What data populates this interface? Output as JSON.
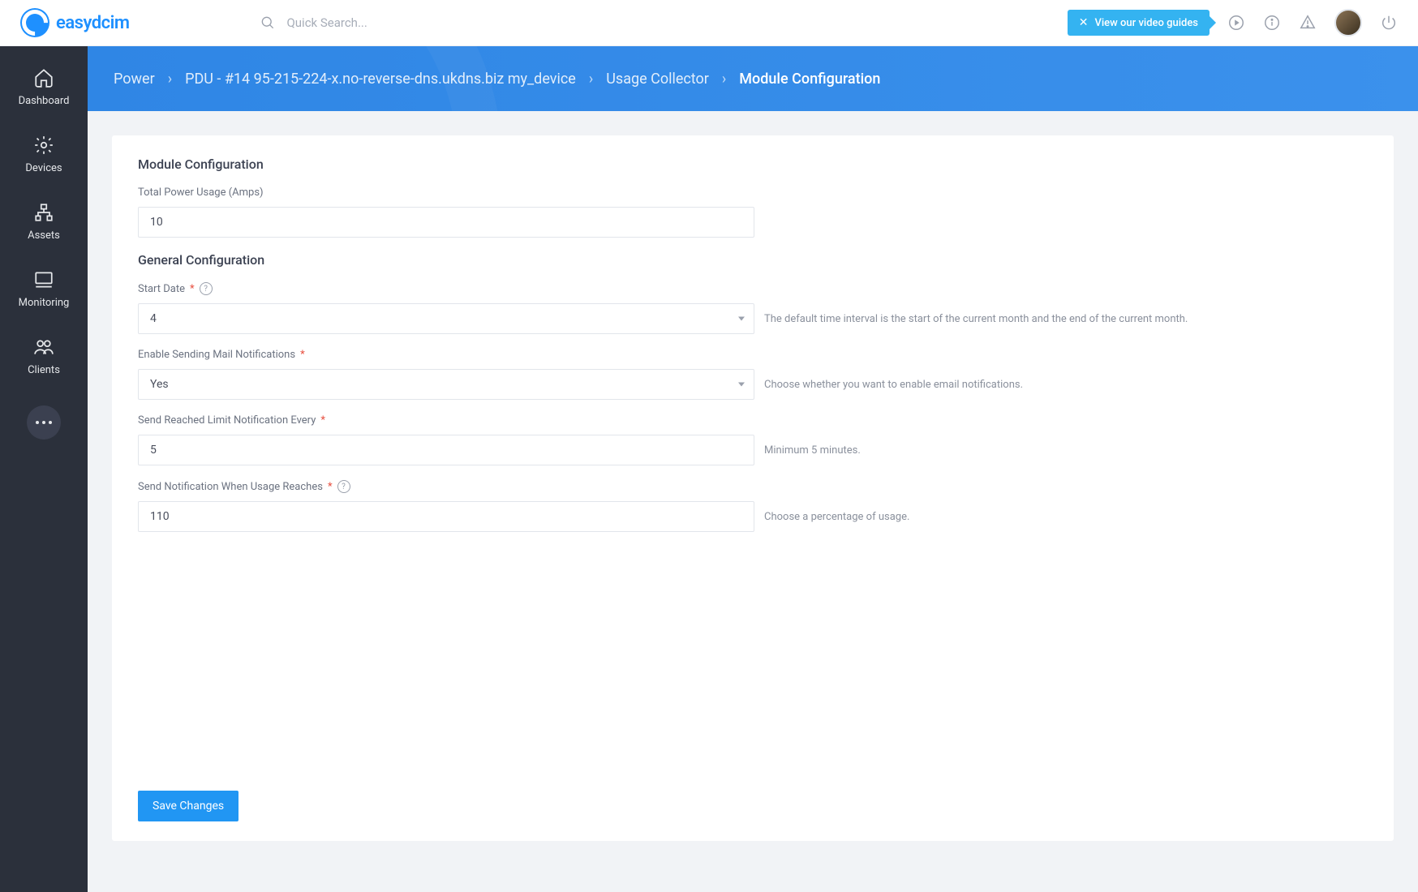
{
  "header": {
    "logo_text_a": "easy",
    "logo_text_b": "dcim",
    "search_placeholder": "Quick Search...",
    "video_guides_label": "View our video guides"
  },
  "sidebar": {
    "items": [
      {
        "label": "Dashboard"
      },
      {
        "label": "Devices"
      },
      {
        "label": "Assets"
      },
      {
        "label": "Monitoring"
      },
      {
        "label": "Clients"
      }
    ]
  },
  "breadcrumb": {
    "items": [
      "Power",
      "PDU - #14 95-215-224-x.no-reverse-dns.ukdns.biz my_device",
      "Usage Collector",
      "Module Configuration"
    ]
  },
  "form": {
    "section1_title": "Module Configuration",
    "total_power_label": "Total Power Usage (Amps)",
    "total_power_value": "10",
    "section2_title": "General Configuration",
    "start_date_label": "Start Date",
    "start_date_value": "4",
    "start_date_hint": "The default time interval is the start of the current month and the end of the current month.",
    "mail_label": "Enable Sending Mail Notifications",
    "mail_value": "Yes",
    "mail_hint": "Choose whether you want to enable email notifications.",
    "limit_label": "Send Reached Limit Notification Every",
    "limit_value": "5",
    "limit_hint": "Minimum 5 minutes.",
    "usage_label": "Send Notification When Usage Reaches",
    "usage_value": "110",
    "usage_hint": "Choose a percentage of usage.",
    "save_label": "Save Changes"
  }
}
